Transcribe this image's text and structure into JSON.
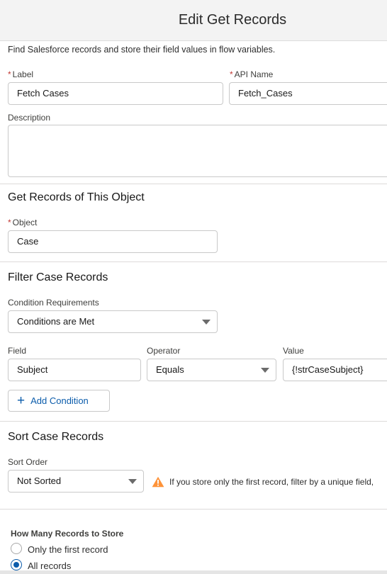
{
  "header": {
    "title": "Edit Get Records"
  },
  "intro": "Find Salesforce records and store their field values in flow variables.",
  "label_field": {
    "label": "Label",
    "value": "Fetch Cases"
  },
  "api_name_field": {
    "label": "API Name",
    "value": "Fetch_Cases"
  },
  "description_field": {
    "label": "Description",
    "value": ""
  },
  "object_section": {
    "title": "Get Records of This Object",
    "object_label": "Object",
    "object_value": "Case"
  },
  "filter_section": {
    "title": "Filter Case Records",
    "condition_label": "Condition Requirements",
    "condition_value": "Conditions are Met",
    "field_header": "Field",
    "operator_header": "Operator",
    "value_header": "Value",
    "condition": {
      "field": "Subject",
      "operator": "Equals",
      "value": "{!strCaseSubject}"
    },
    "add_condition_label": "Add Condition"
  },
  "sort_section": {
    "title": "Sort Case Records",
    "sort_order_label": "Sort Order",
    "sort_order_value": "Not Sorted",
    "warning_text": "If you store only the first record, filter by a unique field,"
  },
  "store_section": {
    "title": "How Many Records to Store",
    "options": [
      {
        "label": "Only the first record",
        "selected": false
      },
      {
        "label": "All records",
        "selected": true
      }
    ]
  },
  "colors": {
    "accent": "#0b5cab",
    "required": "#c23934",
    "warning": "#fe9339"
  }
}
